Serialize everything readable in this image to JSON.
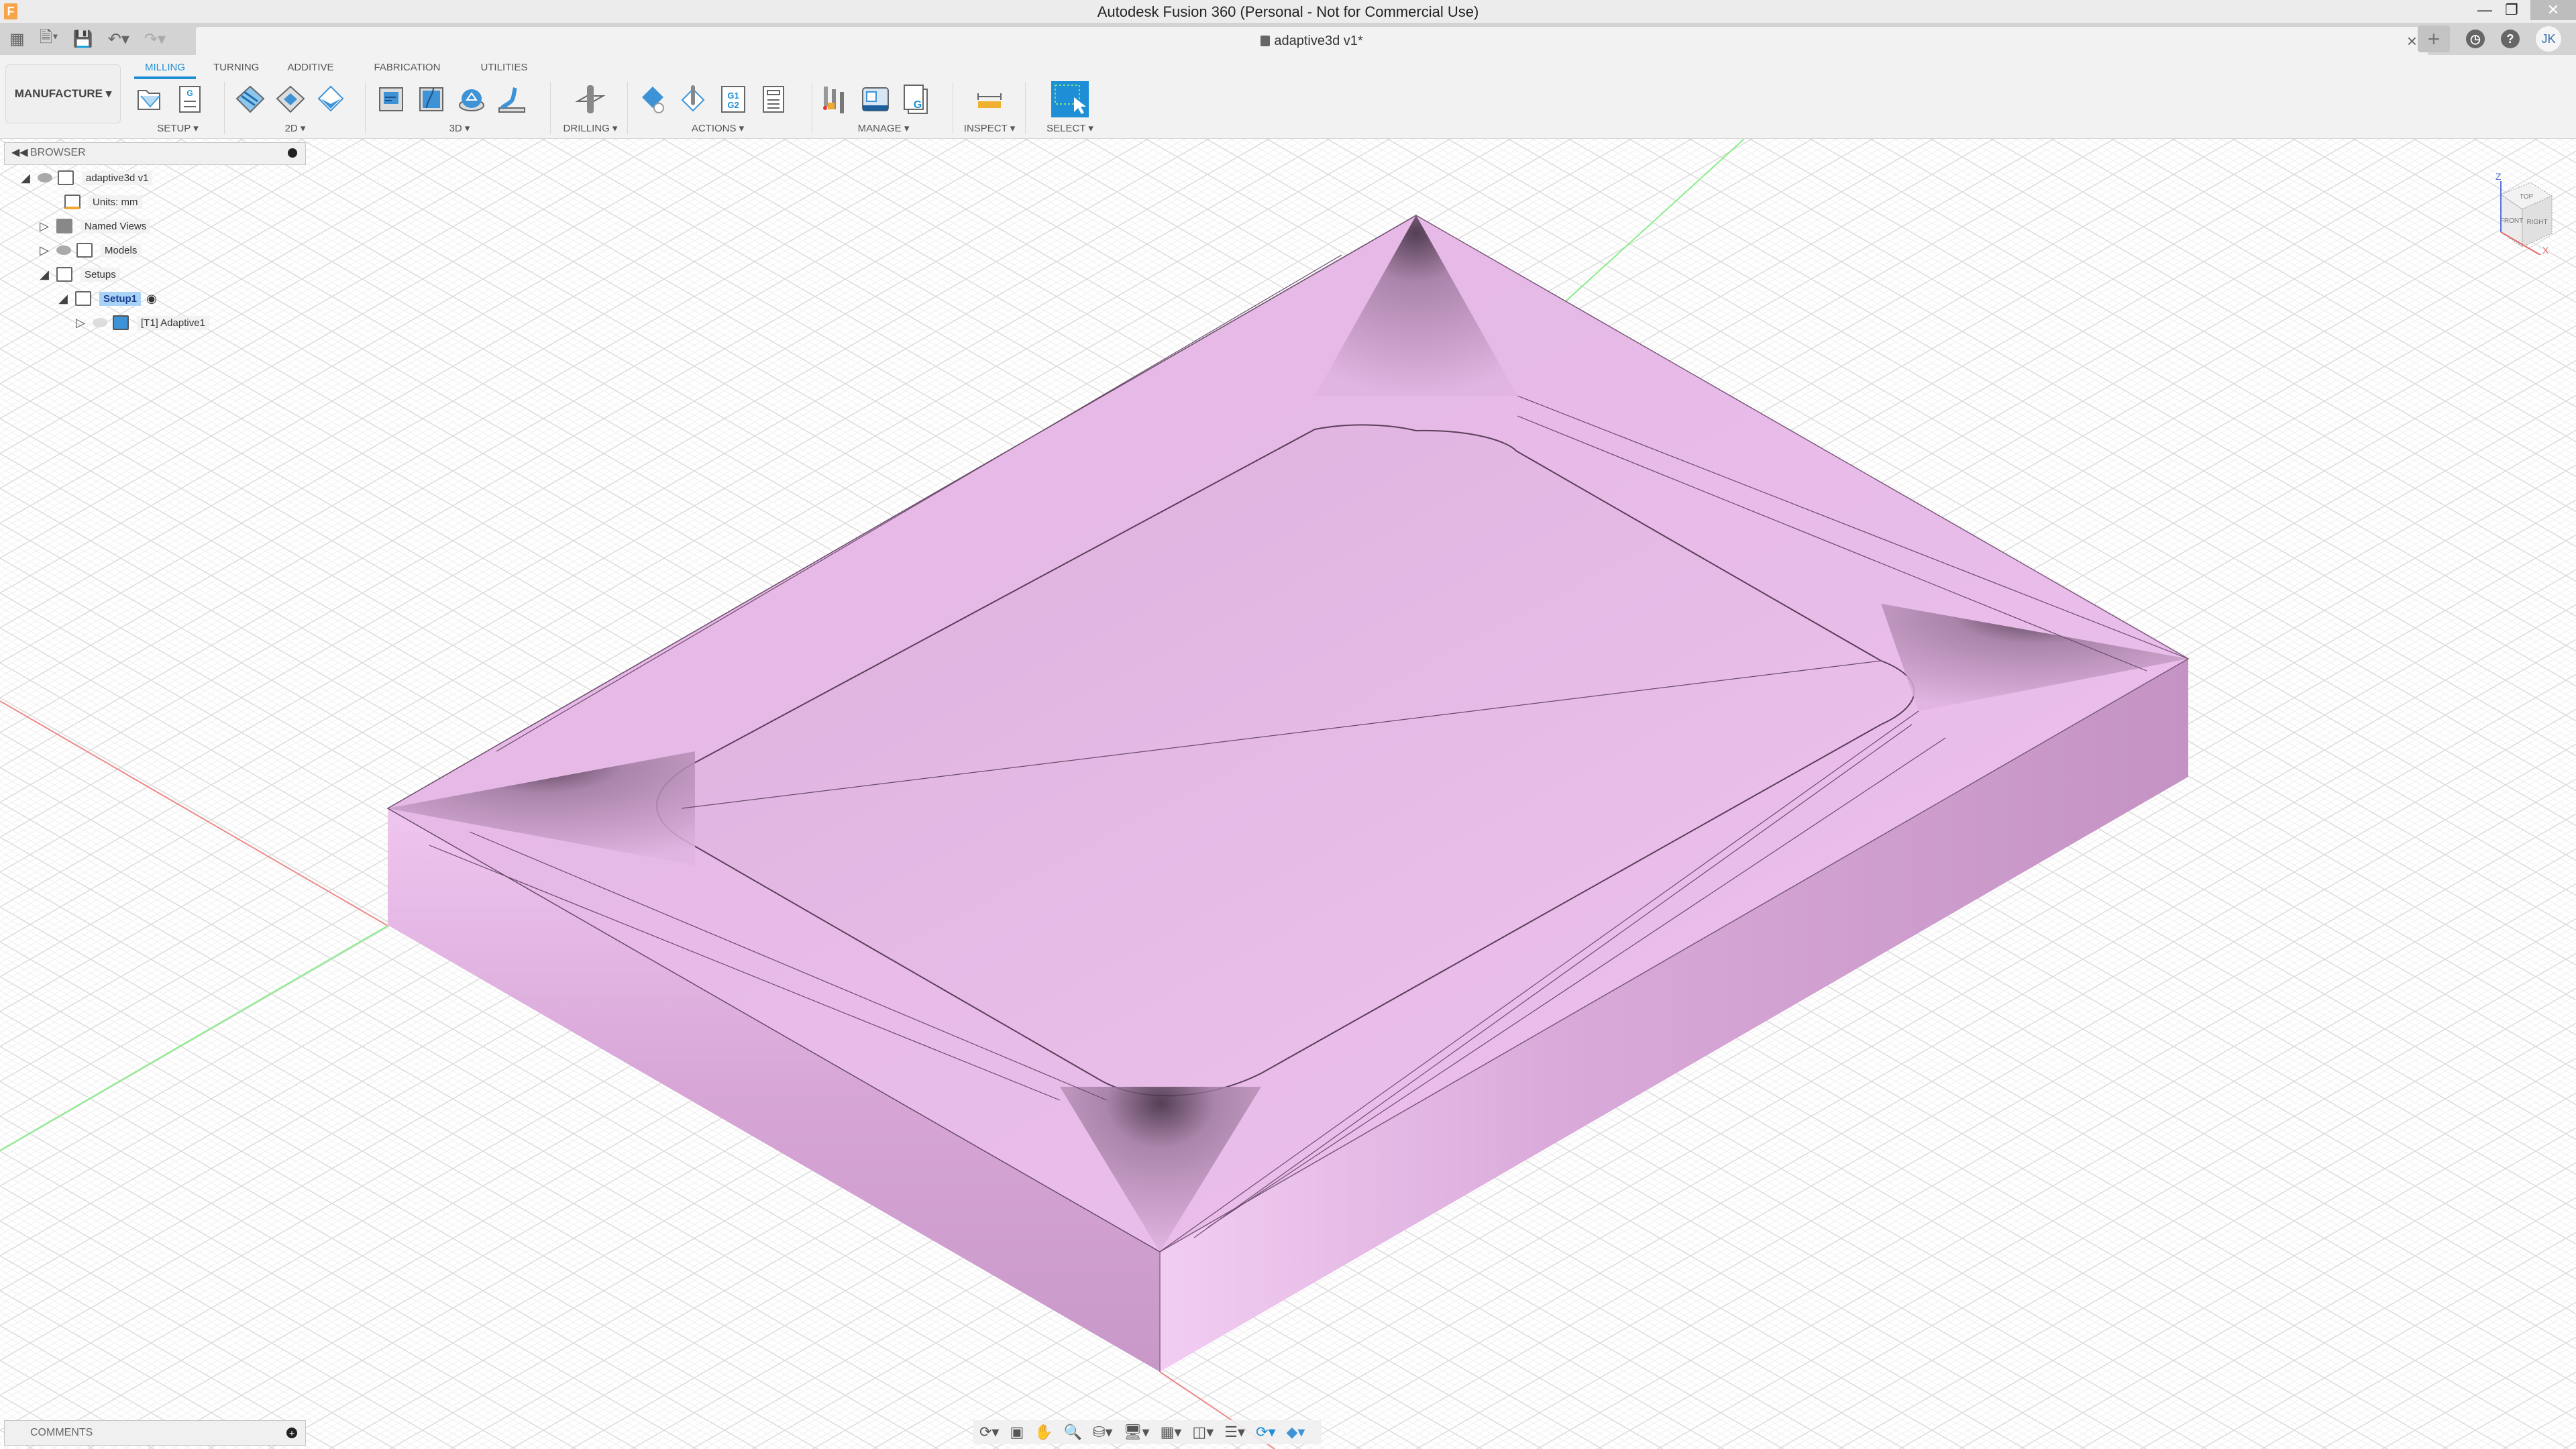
{
  "window": {
    "title": "Autodesk Fusion 360 (Personal - Not for Commercial Use)",
    "app_icon": "F",
    "controls": {
      "minimize": "minimize-icon",
      "restore": "restore-icon",
      "close": "close-icon"
    }
  },
  "quick_access": {
    "icons": [
      "apps-grid-icon",
      "file-icon",
      "save-icon",
      "undo-icon",
      "redo-icon"
    ]
  },
  "document_tab": {
    "title": "adaptive3d v1*",
    "close": "×"
  },
  "header_right": {
    "new_tab": "+",
    "job_status": "clock-icon",
    "help": "?",
    "user_initials": "JK"
  },
  "ribbon": {
    "workspace": "MANUFACTURE ▾",
    "tabs": [
      {
        "label": "MILLING",
        "active": true
      },
      {
        "label": "TURNING",
        "active": false
      },
      {
        "label": "ADDITIVE",
        "active": false
      },
      {
        "label": "FABRICATION",
        "active": false
      },
      {
        "label": "UTILITIES",
        "active": false
      }
    ],
    "groups": [
      {
        "label": "SETUP ▾",
        "icons": [
          "new-setup-icon",
          "nc-program-icon"
        ]
      },
      {
        "label": "2D ▾",
        "icons": [
          "2d-adaptive-icon",
          "2d-pocket-icon",
          "face-icon"
        ]
      },
      {
        "label": "3D ▾",
        "icons": [
          "3d-adaptive-icon",
          "3d-pocket-icon",
          "steep-shallow-icon",
          "scallop-icon"
        ]
      },
      {
        "label": "DRILLING ▾",
        "icons": [
          "drill-icon"
        ]
      },
      {
        "label": "ACTIONS ▾",
        "icons": [
          "simulate-icon",
          "generate-icon",
          "post-process-icon",
          "setup-sheet-icon"
        ]
      },
      {
        "label": "MANAGE ▾",
        "icons": [
          "tool-library-icon",
          "machine-library-icon",
          "post-library-icon"
        ]
      },
      {
        "label": "INSPECT ▾",
        "icons": [
          "measure-icon"
        ]
      },
      {
        "label": "SELECT ▾",
        "icons": [
          "select-icon"
        ]
      }
    ]
  },
  "browser": {
    "title": "BROWSER",
    "tree": [
      {
        "label": "adaptive3d v1",
        "expanded": true,
        "visible": true,
        "icon": "component-icon",
        "level": 0
      },
      {
        "label": "Units: mm",
        "icon": "units-icon",
        "level": 1
      },
      {
        "label": "Named Views",
        "expanded": false,
        "icon": "folder-icon",
        "level": 1
      },
      {
        "label": "Models",
        "expanded": false,
        "visible": true,
        "icon": "component-icon",
        "level": 1
      },
      {
        "label": "Setups",
        "expanded": true,
        "icon": "folder-open-icon",
        "level": 1
      },
      {
        "label": "Setup1",
        "expanded": true,
        "selected": true,
        "icon": "folder-open-icon",
        "level": 2,
        "active_marker": true
      },
      {
        "label": "[T1] Adaptive1",
        "expanded": false,
        "visible": false,
        "icon": "adaptive-toolpath-icon",
        "level": 3
      }
    ]
  },
  "comments": {
    "title": "COMMENTS"
  },
  "viewcube": {
    "faces": [
      "TOP",
      "FRONT",
      "RIGHT"
    ],
    "axes": [
      "Z",
      "X"
    ]
  },
  "nav_toolbar": {
    "icons": [
      "orbit-icon",
      "look-at-icon",
      "pan-icon",
      "zoom-icon",
      "fit-icon",
      "display-settings-icon",
      "grid-icon",
      "viewports-icon",
      "environment-icon",
      "refresh-icon",
      "effects-icon"
    ]
  },
  "colors": {
    "accent": "#1e8fd6",
    "stock": "#e9bde9",
    "stock_dark": "#b98cb9",
    "grid": "#d9d9d9",
    "x_axis": "#e25a5a",
    "y_axis": "#5ed65e"
  }
}
